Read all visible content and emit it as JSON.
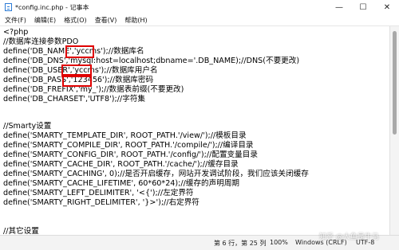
{
  "window": {
    "title": "*config.inc.php - 记事本",
    "controls": {
      "minimize": "—",
      "maximize": "☐",
      "close": "✕"
    }
  },
  "menu": [
    "文件(F)",
    "编辑(E)",
    "格式(O)",
    "查看(V)",
    "帮助(H)"
  ],
  "editor": {
    "lines": [
      "<?php",
      "//数据库连接参数PDO",
      "define('DB_NAME','yccms');//数据库名",
      "define('DB_DNS','mysql:host=localhost;dbname='.DB_NAME);//DNS(不要更改)",
      "define('DB_USER','yccms');//数据库用户名",
      "define('DB_PASS','123456');//数据库密码",
      "define('DB_FREFIX','my_');//数据表前缀(不要更改)",
      "define('DB_CHARSET','UTF8');//字符集",
      "",
      "//Smarty设置",
      "define('SMARTY_TEMPLATE_DIR', ROOT_PATH.'/view/');//模板目录",
      "define('SMARTY_COMPILE_DIR', ROOT_PATH.'/compile/');//编译目录",
      "define('SMARTY_CONFIG_DIR', ROOT_PATH.'/config/');//配置变量目录",
      "define('SMARTY_CACHE_DIR', ROOT_PATH.'/cache/');//缓存目录",
      "define('SMARTY_CACHING', 0);//是否开启缓存，网站开发调试阶段，我们应该关闭缓存",
      "define('SMARTY_CACHE_LIFETIME', 60*60*24);//缓存的声明周期",
      "define('SMARTY_LEFT_DELIMITER', '<{');//左定界符",
      "define('SMARTY_RIGHT_DELIMITER', '}>');//右定界符",
      "",
      "",
      "//其它设置"
    ],
    "highlight_color": "#e00000"
  },
  "status": {
    "position": "第 6 行，第 25 列",
    "zoom": "100%",
    "eol": "Windows (CRLF)",
    "encoding": "UTF-8"
  },
  "watermark": "知乎 @大鱼是牛马"
}
